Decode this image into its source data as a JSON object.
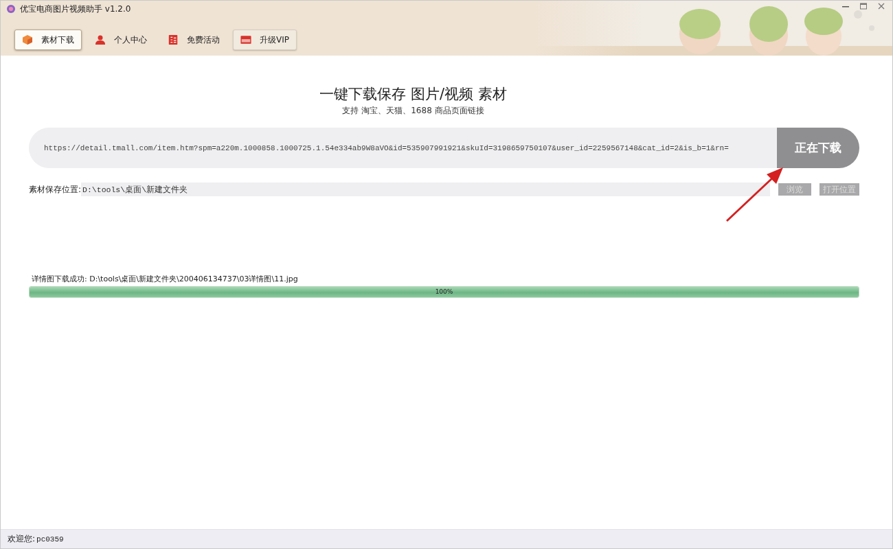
{
  "window": {
    "title": "优宝电商图片视频助手 v1.2.0"
  },
  "nav": [
    {
      "label": "素材下载",
      "selected": true,
      "hovered": false
    },
    {
      "label": "个人中心",
      "selected": false,
      "hovered": false
    },
    {
      "label": "免费活动",
      "selected": false,
      "hovered": false
    },
    {
      "label": "升级VIP",
      "selected": false,
      "hovered": true
    }
  ],
  "headline": "一键下载保存 图片/视频 素材",
  "subline": "支持 淘宝、天猫、1688 商品页面链接",
  "url_field": {
    "value": "https://detail.tmall.com/item.htm?spm=a220m.1000858.1000725.1.54e334ab9W8aVO&id=535907991921&skuId=3198659750107&user_id=2259567148&cat_id=2&is_b=1&rn="
  },
  "download_button": {
    "label": "正在下载",
    "disabled": true
  },
  "save_location": {
    "label": "素材保存位置:",
    "value": "D:\\tools\\桌面\\新建文件夹",
    "browse_button": "浏览",
    "open_button": "打开位置",
    "disabled": true
  },
  "status_message": "详情图下载成功: D:\\tools\\桌面\\新建文件夹\\200406134737\\03详情图\\11.jpg",
  "progress": {
    "level": 1,
    "label": "100%"
  },
  "status_bar": {
    "label": "欢迎您:",
    "user": "pc0359"
  }
}
